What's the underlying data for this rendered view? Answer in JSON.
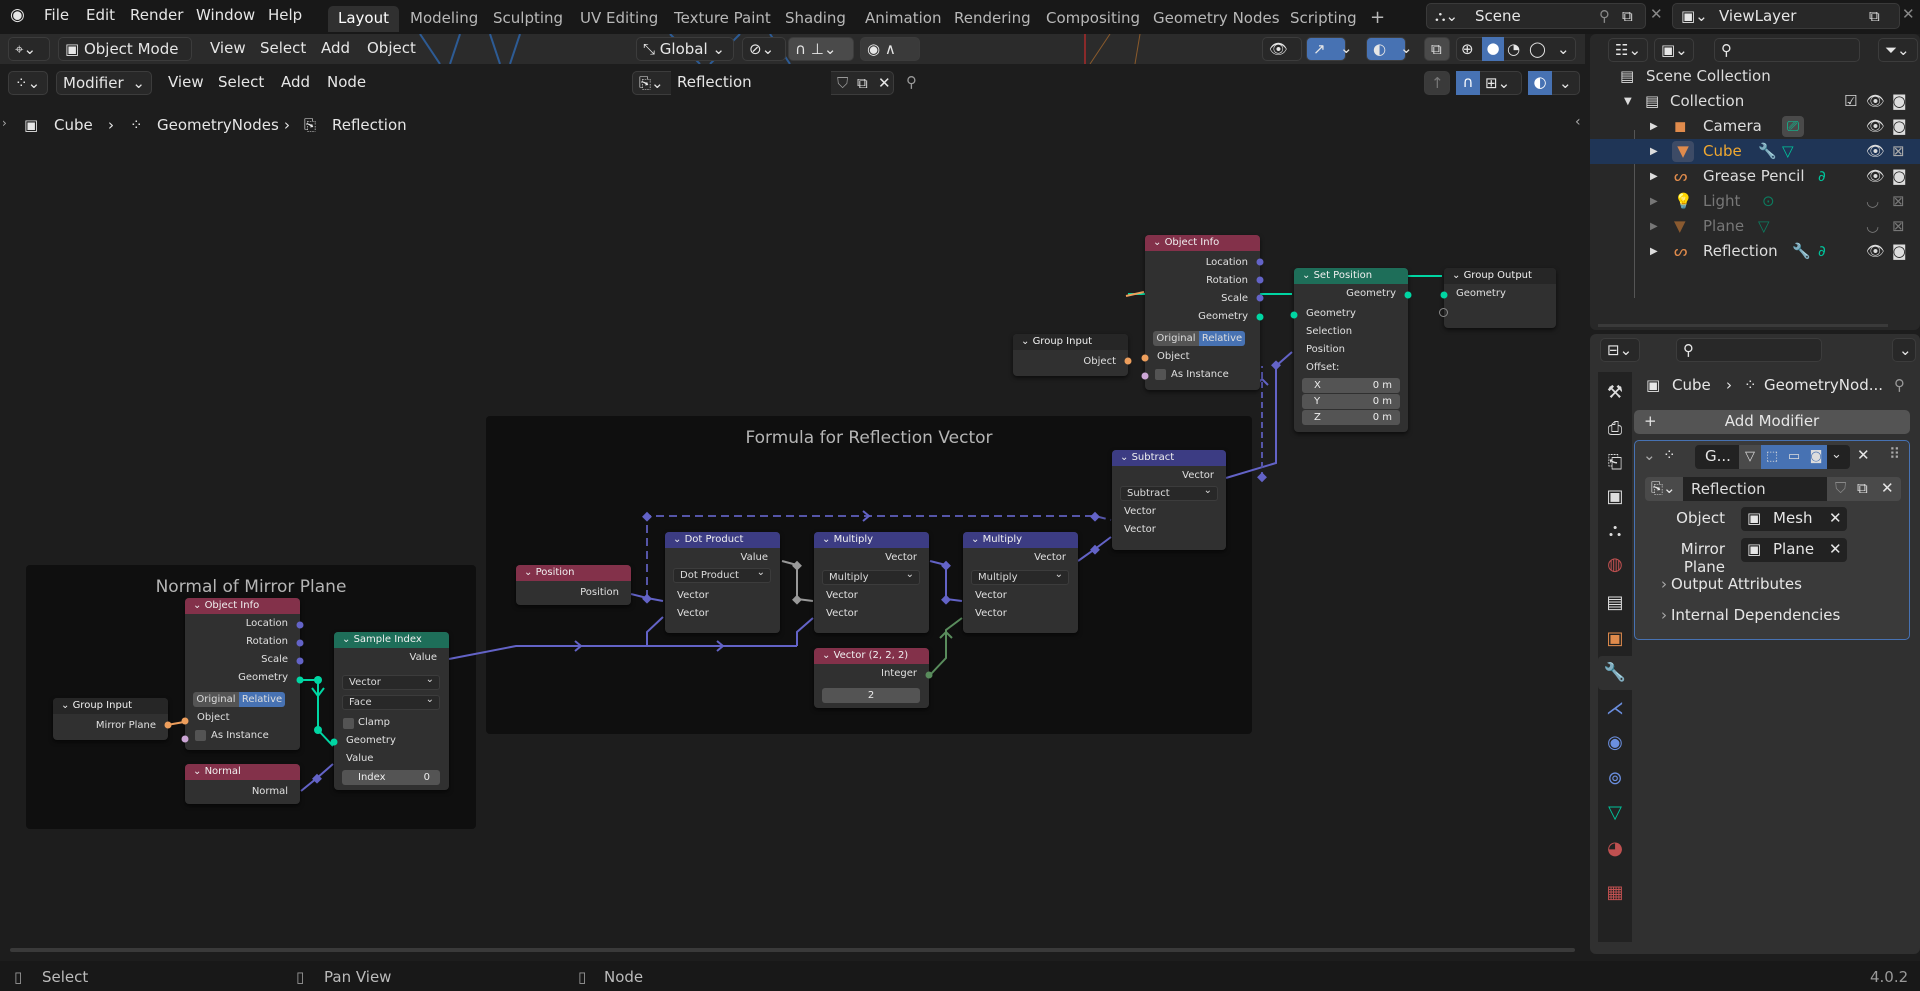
{
  "topbar": {
    "menus": [
      "File",
      "Edit",
      "Render",
      "Window",
      "Help"
    ],
    "workspace_tabs": [
      "Layout",
      "Modeling",
      "Sculpting",
      "UV Editing",
      "Texture Paint",
      "Shading",
      "Animation",
      "Rendering",
      "Compositing",
      "Geometry Nodes",
      "Scripting"
    ],
    "active_tab": "Layout",
    "add_tab": "+",
    "scene": "Scene",
    "view_layer": "ViewLayer"
  },
  "viewport_header": {
    "mode": "Object Mode",
    "menus": [
      "View",
      "Select",
      "Add",
      "Object"
    ],
    "transform_orientation": "Global"
  },
  "node_header": {
    "editor_type": "Modifier",
    "menus": [
      "View",
      "Select",
      "Add",
      "Node"
    ],
    "node_tree": "Reflection"
  },
  "breadcrumb": [
    "Cube",
    "GeometryNodes",
    "Reflection"
  ],
  "frames": {
    "formula": "Formula for Reflection Vector",
    "normal": "Normal of Mirror Plane"
  },
  "nodes": {
    "object_info_top": {
      "title": "Object Info",
      "outputs": [
        "Location",
        "Rotation",
        "Scale",
        "Geometry"
      ],
      "seg": [
        "Original",
        "Relative"
      ],
      "active_seg": "Relative",
      "inputs": [
        "Object",
        "As Instance"
      ]
    },
    "group_input_top": {
      "title": "Group Input",
      "output": "Object"
    },
    "set_position": {
      "title": "Set Position",
      "output": "Geometry",
      "inputs": [
        "Geometry",
        "Selection",
        "Position",
        "Offset:"
      ],
      "offset": [
        {
          "axis": "X",
          "value": "0 m"
        },
        {
          "axis": "Y",
          "value": "0 m"
        },
        {
          "axis": "Z",
          "value": "0 m"
        }
      ]
    },
    "group_output": {
      "title": "Group Output",
      "input": "Geometry"
    },
    "subtract": {
      "title": "Subtract",
      "output": "Vector",
      "op": "Subtract",
      "inputs": [
        "Vector",
        "Vector"
      ]
    },
    "position": {
      "title": "Position",
      "output": "Position"
    },
    "dot_product": {
      "title": "Dot Product",
      "output": "Value",
      "op": "Dot Product",
      "inputs": [
        "Vector",
        "Vector"
      ]
    },
    "multiply1": {
      "title": "Multiply",
      "output": "Vector",
      "op": "Multiply",
      "inputs": [
        "Vector",
        "Vector"
      ]
    },
    "multiply2": {
      "title": "Multiply",
      "output": "Vector",
      "op": "Multiply",
      "inputs": [
        "Vector",
        "Vector"
      ]
    },
    "vector222": {
      "title": "Vector (2, 2, 2)",
      "output": "Integer",
      "value": "2"
    },
    "object_info_bottom": {
      "title": "Object Info",
      "outputs": [
        "Location",
        "Rotation",
        "Scale",
        "Geometry"
      ],
      "seg": [
        "Original",
        "Relative"
      ],
      "active_seg": "Relative",
      "inputs": [
        "Object",
        "As Instance"
      ]
    },
    "group_input_bottom": {
      "title": "Group Input",
      "output": "Mirror Plane"
    },
    "normal": {
      "title": "Normal",
      "output": "Normal"
    },
    "sample_index": {
      "title": "Sample Index",
      "output": "Value",
      "data_type": "Vector",
      "domain": "Face",
      "clamp": "Clamp",
      "inputs": [
        "Geometry",
        "Value"
      ],
      "index_label": "Index",
      "index_value": "0"
    }
  },
  "outliner": {
    "scene_collection": "Scene Collection",
    "collection": "Collection",
    "items": [
      {
        "name": "Camera",
        "selected": false,
        "disabled": false
      },
      {
        "name": "Cube",
        "selected": true,
        "disabled": false
      },
      {
        "name": "Grease Pencil",
        "selected": false,
        "disabled": false
      },
      {
        "name": "Light",
        "selected": false,
        "disabled": true
      },
      {
        "name": "Plane",
        "selected": false,
        "disabled": true
      },
      {
        "name": "Reflection",
        "selected": false,
        "disabled": false
      }
    ]
  },
  "properties": {
    "breadcrumb": [
      "Cube",
      "GeometryNod..."
    ],
    "add_modifier": "Add Modifier",
    "modifier_name": "G...",
    "node_group": "Reflection",
    "fields": [
      {
        "label": "Object",
        "value": "Mesh"
      },
      {
        "label": "Mirror Plane",
        "value": "Plane"
      }
    ],
    "panels": [
      "Output Attributes",
      "Internal Dependencies"
    ]
  },
  "statusbar": {
    "items": [
      "Select",
      "Pan View",
      "Node"
    ],
    "version": "4.0.2"
  },
  "colors": {
    "accent_blue": "#4772b3",
    "selected_row": "#1f3556",
    "geometry_socket": "#00d6a3",
    "vector_socket": "#6363c7",
    "object_socket": "#ed9e5c",
    "int_socket": "#598c5c",
    "input_node_header": "#83314a",
    "vector_node_header": "#3c3c83",
    "geometry_node_header": "#1e6e59"
  }
}
